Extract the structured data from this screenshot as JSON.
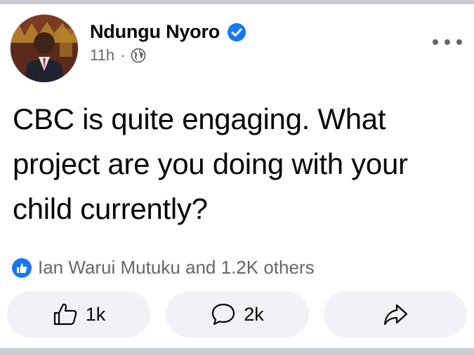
{
  "post": {
    "author": "Ndungu Nyoro",
    "verified": true,
    "time": "11h",
    "separator": "·",
    "audience_icon": "globe-icon",
    "text": "CBC is quite engaging. What project are you doing with your child currently?"
  },
  "reactions": {
    "icon": "like-icon",
    "summary": "Ian Warui Mutuku and 1.2K others"
  },
  "actions": {
    "like_count": "1k",
    "comment_count": "2k",
    "share_icon": "share-icon"
  },
  "colors": {
    "accent": "#1877f2",
    "secondary_text": "#65676b",
    "button_bg": "#f0f2f5",
    "divider": "#c9ccd1"
  }
}
